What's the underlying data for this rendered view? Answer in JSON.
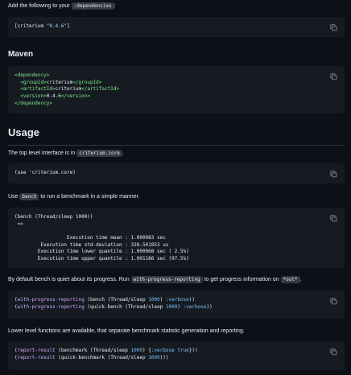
{
  "intro": {
    "text_before": "Add the following to your ",
    "code": ":dependencies",
    "text_after": ":"
  },
  "lein_block": {
    "open": "[criterium ",
    "version": "\"0.4.6\"",
    "close": "]"
  },
  "maven": {
    "heading": "Maven",
    "lines": [
      {
        "tag": "<dependency>"
      },
      {
        "open": "<groupId>",
        "value": "criterium",
        "close": "</groupId>"
      },
      {
        "open": "<artifactId>",
        "value": "criterium",
        "close": "</artifactId>"
      },
      {
        "open": "<version>",
        "value": "0.4.6",
        "close": "</version>"
      },
      {
        "tag": "</dependency>"
      }
    ]
  },
  "usage": {
    "heading": "Usage",
    "p1_before": "The top level interface is in ",
    "p1_code": "criterium.core",
    "p1_after": ".",
    "block1": "(use 'criterium.core)",
    "p2_before": "Use ",
    "p2_code": "bench",
    "p2_after": " to run a benchmark in a simple manner.",
    "block2_lines": [
      "(bench (Thread/sleep 1000))",
      " =>",
      "                  Execution time mean : 1.000083 sec",
      "         Execution time std-deviation : 328.501853 us",
      "        Execution time lower quantile : 1.000068 sec ( 2.5%)",
      "        Execution time upper quantile : 1.001186 sec (97.5%)"
    ],
    "p3_before": "By default bench is quiet about its progress. Run ",
    "p3_code1": "with-progress-reporting",
    "p3_middle": " to get progress information on ",
    "p3_code2": "*out*",
    "p3_after": ".",
    "block3": {
      "l1_fn": "with-progress-reporting",
      "l1_mid": " (bench (Thread/sleep ",
      "l1_num": "1000",
      "l1_close": ") ",
      "l1_kw": ":verbose",
      "l1_end": "))",
      "l2_fn": "with-progress-reporting",
      "l2_mid": " (quick-bench (Thread/sleep ",
      "l2_num": "1000",
      "l2_close": ") ",
      "l2_kw": ":verbose",
      "l2_end": "))"
    },
    "p4": "Lower level functions are available, that separate benchmark statistic generation and reporting.",
    "block4": {
      "l1_fn": "report-result",
      "l1_mid": " (benchmark (Thread/sleep ",
      "l1_num": "1000",
      "l1_close": ") {",
      "l1_kw": ":verbose",
      "l1_sp": " ",
      "l1_bool": "true",
      "l1_end": "}))",
      "l2_fn": "report-result",
      "l2_mid": " (quick-benchmark (Thread/sleep ",
      "l2_num": "1000",
      "l2_end": ")))"
    }
  },
  "icons": {
    "copy": "copy-icon"
  },
  "colors": {
    "background": "#0d1117",
    "code_block": "#161b22",
    "text": "#e6edf3",
    "tag_green": "#7ee787",
    "value_blue": "#79c0ff",
    "fn_purple": "#d2a8ff"
  }
}
